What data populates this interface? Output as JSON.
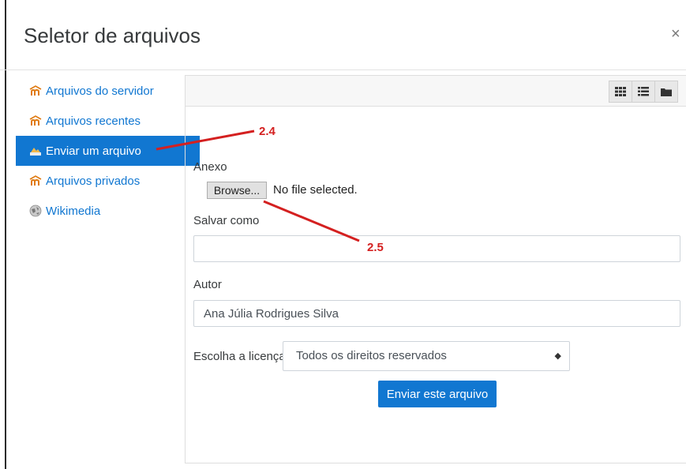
{
  "dialog": {
    "title": "Seletor de arquivos",
    "close_symbol": "×"
  },
  "sidebar": {
    "items": [
      {
        "label": "Arquivos do servidor",
        "icon": "moodle-icon",
        "active": false
      },
      {
        "label": "Arquivos recentes",
        "icon": "moodle-icon",
        "active": false
      },
      {
        "label": "Enviar um arquivo",
        "icon": "upload-icon",
        "active": true
      },
      {
        "label": "Arquivos privados",
        "icon": "moodle-icon",
        "active": false
      },
      {
        "label": "Wikimedia",
        "icon": "wikimedia-icon",
        "active": false
      }
    ]
  },
  "toolbar": {
    "views": [
      "grid-view-icon",
      "list-view-icon",
      "folder-view-icon"
    ]
  },
  "form": {
    "attachment_label": "Anexo",
    "browse_label": "Browse...",
    "file_status": "No file selected.",
    "save_as_label": "Salvar como",
    "save_as_value": "",
    "author_label": "Autor",
    "author_value": "Ana Júlia Rodrigues Silva",
    "license_label": "Escolha a licença",
    "license_value": "Todos os direitos reservados",
    "submit_label": "Enviar este arquivo"
  },
  "annotations": {
    "step_a": "2.4",
    "step_b": "2.5",
    "color": "#d42020"
  },
  "colors": {
    "accent": "#1177d1"
  }
}
